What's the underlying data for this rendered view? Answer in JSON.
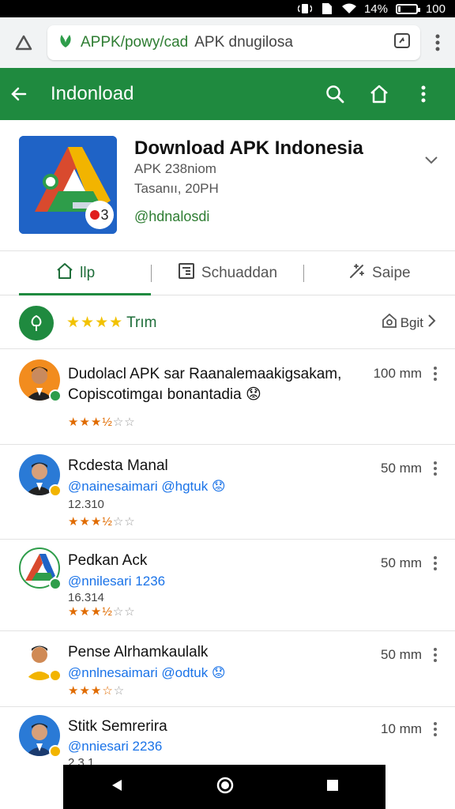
{
  "status_bar": {
    "battery": "14%",
    "time": "100"
  },
  "browser": {
    "url_domain": "APPK/powy/cad",
    "url_rest": "APK dnugilosa"
  },
  "app_bar": {
    "title": "Indonload"
  },
  "app": {
    "title": "Download APK Indonesia",
    "line1": "APK 238niom",
    "line2": "Tasanıı, 20PH",
    "link": "@hdnalosdi",
    "badge": "3"
  },
  "tabs": [
    {
      "label": "llp",
      "icon": "home-icon"
    },
    {
      "label": "Schuaddan",
      "icon": "list-icon"
    },
    {
      "label": "Saipe",
      "icon": "magic-icon"
    }
  ],
  "rating": {
    "stars": "★★★★",
    "label": "Trım",
    "right_label": "Bgit"
  },
  "reviews": [
    {
      "text": "Dudolacl APK sar Raanalemaakigsakam, Copiscotimgaı bonantadia 😟",
      "time": "100 mm",
      "stars": "★★★",
      "half": "½",
      "empty": "☆☆"
    },
    {
      "name": "Rcdesta Manal",
      "handle": "@nainesaimari @hgtuk 😟",
      "num": "12.310",
      "time": "50 mm",
      "stars": "★★★",
      "half": "½",
      "empty": "☆☆"
    },
    {
      "name": "Pedkan Ack",
      "handle": "@nnilesari 1236",
      "num": "16.314",
      "time": "50 mm",
      "stars": "★★★",
      "half": "½",
      "empty": "☆☆"
    },
    {
      "name": "Pense Alrhamkaulalk",
      "handle": "@nnlnesaimari @odtuk 😟",
      "time": "50 mm",
      "stars": "★★★",
      "half": "☆",
      "empty": "☆"
    },
    {
      "name": "Stitk Semrerira",
      "handle": "@nniesari 2236",
      "num": "2 3 1",
      "time": "10 mm"
    }
  ],
  "colors": {
    "primary": "#1f8a3f",
    "link": "#1a73e8",
    "star": "#f2c200"
  }
}
